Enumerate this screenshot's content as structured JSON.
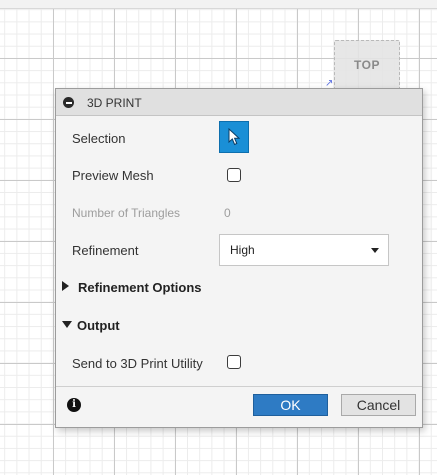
{
  "viewcube": {
    "label": "TOP"
  },
  "dialog": {
    "title": "3D PRINT",
    "selection_label": "Selection",
    "preview_mesh_label": "Preview Mesh",
    "preview_mesh_checked": false,
    "num_triangles_label": "Number of Triangles",
    "num_triangles_value": "0",
    "refinement_label": "Refinement",
    "refinement_value": "High",
    "refinement_options_label": "Refinement Options",
    "refinement_options_expanded": false,
    "output_label": "Output",
    "output_expanded": true,
    "send_to_utility_label": "Send to 3D Print Utility",
    "send_to_utility_checked": false,
    "info_glyph": "i",
    "ok_label": "OK",
    "cancel_label": "Cancel"
  },
  "colors": {
    "selection_active": "#1a8fd6",
    "ok_button": "#2e7bc4"
  }
}
